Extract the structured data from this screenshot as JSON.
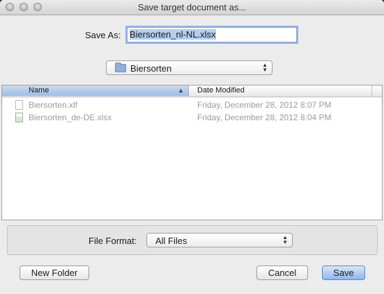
{
  "window": {
    "title": "Save target document as..."
  },
  "save_as": {
    "label": "Save As:",
    "value": "Biersorten_nl-NL.xlsx"
  },
  "location": {
    "folder": "Biersorten",
    "icon": "folder-icon"
  },
  "columns": {
    "name": "Name",
    "date_modified": "Date Modified"
  },
  "files": [
    {
      "name": "Biersorten.xlf",
      "date": "Friday, December 28, 2012 8:07 PM",
      "icon": "document-icon"
    },
    {
      "name": "Biersorten_de-DE.xlsx",
      "date": "Friday, December 28, 2012 8:04 PM",
      "icon": "spreadsheet-icon"
    }
  ],
  "file_format": {
    "label": "File Format:",
    "value": "All Files"
  },
  "buttons": {
    "new_folder": "New Folder",
    "cancel": "Cancel",
    "save": "Save"
  },
  "colors": {
    "accent": "#8fb6ec",
    "selection": "#b4cfee"
  }
}
